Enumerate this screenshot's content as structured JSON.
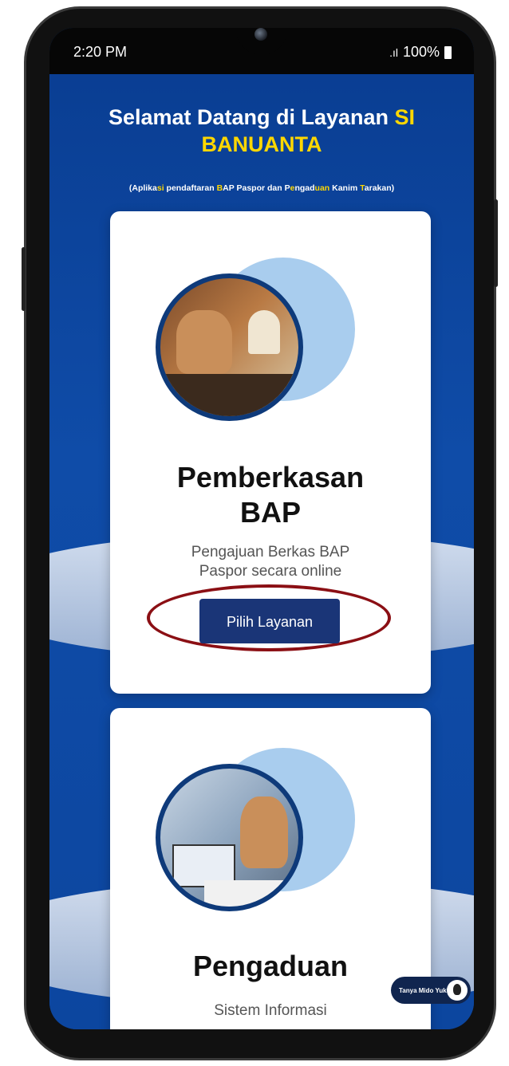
{
  "status_bar": {
    "time": "2:20 PM",
    "signal": ".ıl",
    "battery": "100%"
  },
  "header": {
    "title_part1": "Selamat Datang di Layanan ",
    "title_highlight1": "SI",
    "title_highlight2": "BANUANTA",
    "subtitle_parts": [
      {
        "text": "(Aplika",
        "hl": false
      },
      {
        "text": "si",
        "hl": true
      },
      {
        "text": " pendaftaran ",
        "hl": false
      },
      {
        "text": "B",
        "hl": true
      },
      {
        "text": "AP Paspor dan P",
        "hl": false
      },
      {
        "text": "e",
        "hl": true
      },
      {
        "text": "ngad",
        "hl": false
      },
      {
        "text": "uan",
        "hl": true
      },
      {
        "text": " Kanim ",
        "hl": false
      },
      {
        "text": "T",
        "hl": true
      },
      {
        "text": "arakan)",
        "hl": false
      }
    ]
  },
  "cards": [
    {
      "title_line1": "Pemberkasan",
      "title_line2": "BAP",
      "desc_line1": "Pengajuan Berkas BAP",
      "desc_line2": "Paspor secara online",
      "button_label": "Pilih Layanan",
      "illustration": "officer-serving-applicant"
    },
    {
      "title_line1": "Pengaduan",
      "desc_line1": "Sistem Informasi",
      "illustration": "officer-at-computer-headset"
    }
  ],
  "chat_widget": {
    "label": "Tanya Mido Yuk!"
  },
  "colors": {
    "primary_bg": "#0b3c8c",
    "highlight": "#ffd700",
    "button": "#1a3577",
    "annotation": "#8b0f14"
  }
}
